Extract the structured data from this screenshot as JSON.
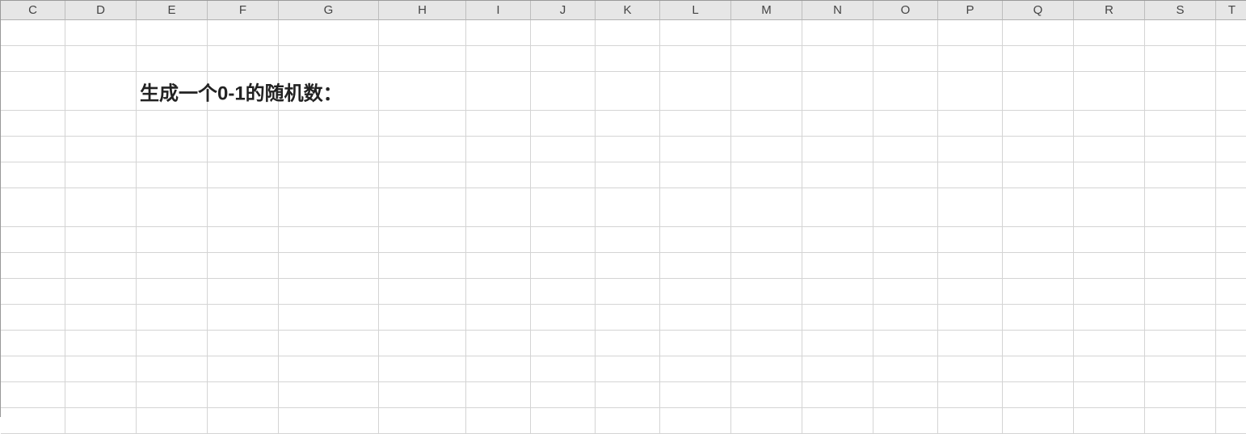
{
  "columns": [
    {
      "label": "C",
      "width": 80
    },
    {
      "label": "D",
      "width": 88
    },
    {
      "label": "E",
      "width": 88
    },
    {
      "label": "F",
      "width": 88
    },
    {
      "label": "G",
      "width": 124
    },
    {
      "label": "H",
      "width": 108
    },
    {
      "label": "I",
      "width": 80
    },
    {
      "label": "J",
      "width": 80
    },
    {
      "label": "K",
      "width": 80
    },
    {
      "label": "L",
      "width": 88
    },
    {
      "label": "M",
      "width": 88
    },
    {
      "label": "N",
      "width": 88
    },
    {
      "label": "O",
      "width": 80
    },
    {
      "label": "P",
      "width": 80
    },
    {
      "label": "Q",
      "width": 88
    },
    {
      "label": "R",
      "width": 88
    },
    {
      "label": "S",
      "width": 88
    },
    {
      "label": "T",
      "width": 40
    }
  ],
  "rows": [
    {
      "height": 32,
      "cells": {}
    },
    {
      "height": 32,
      "cells": {}
    },
    {
      "height": 48,
      "cells": {
        "E": {
          "text": "生成一个0-1的随机数：",
          "style": "bold-large",
          "overflow": true
        }
      }
    },
    {
      "height": 32,
      "cells": {}
    },
    {
      "height": 32,
      "cells": {}
    },
    {
      "height": 32,
      "cells": {}
    },
    {
      "height": 48,
      "cells": {}
    },
    {
      "height": 32,
      "cells": {}
    },
    {
      "height": 32,
      "cells": {}
    },
    {
      "height": 32,
      "cells": {}
    },
    {
      "height": 32,
      "cells": {}
    },
    {
      "height": 32,
      "cells": {}
    },
    {
      "height": 32,
      "cells": {}
    },
    {
      "height": 32,
      "cells": {}
    },
    {
      "height": 32,
      "cells": {}
    }
  ]
}
